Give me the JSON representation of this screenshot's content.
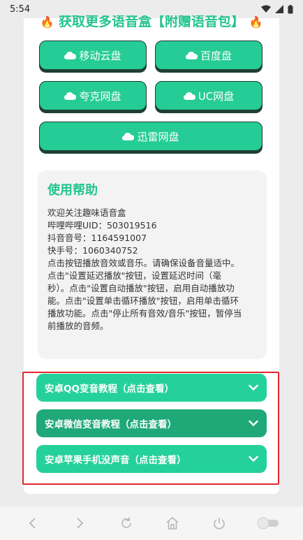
{
  "status_bar": {
    "time": "5:54"
  },
  "header": {
    "title_left_icon": "🔥",
    "title": "获取更多语音盒【附赠语音包】",
    "title_right_icon": "🔥"
  },
  "downloads": [
    {
      "label": "移动云盘",
      "icon": "cloud-icon"
    },
    {
      "label": "百度盘",
      "icon": "cloud-icon"
    },
    {
      "label": "夸克网盘",
      "icon": "cloud-icon"
    },
    {
      "label": "UC网盘",
      "icon": "cloud-icon"
    },
    {
      "label": "迅雷网盘",
      "icon": "cloud-icon"
    }
  ],
  "help": {
    "title": "使用帮助",
    "lines": [
      "欢迎关注趣味语音盒",
      "哔哩哔哩UID：503019516",
      "抖音音号：1164591007",
      "快手号：1060340752",
      "点击按钮播放音效或音乐。请确保设备音量适中。",
      "点击\"设置延迟播放\"按钮，设置延迟时间（毫",
      "秒）。点击\"设置自动播放\"按钮，启用自动播放功",
      "能。点击\"设置单击循环播放\"按钮，启用单击循环",
      "播放功能。点击\"停止所有音效/音乐\"按钮，暂停当",
      "前播放的音频。"
    ]
  },
  "tutorials": [
    {
      "label": "安卓QQ变音教程（点击查看）"
    },
    {
      "label": "安卓微信变音教程（点击查看）"
    },
    {
      "label": "安卓苹果手机没声音（点击查看）"
    }
  ],
  "colors": {
    "accent": "#25cc95",
    "accent_dark": "#1fa878",
    "highlight": "#e0282e",
    "title": "#23c48e"
  }
}
